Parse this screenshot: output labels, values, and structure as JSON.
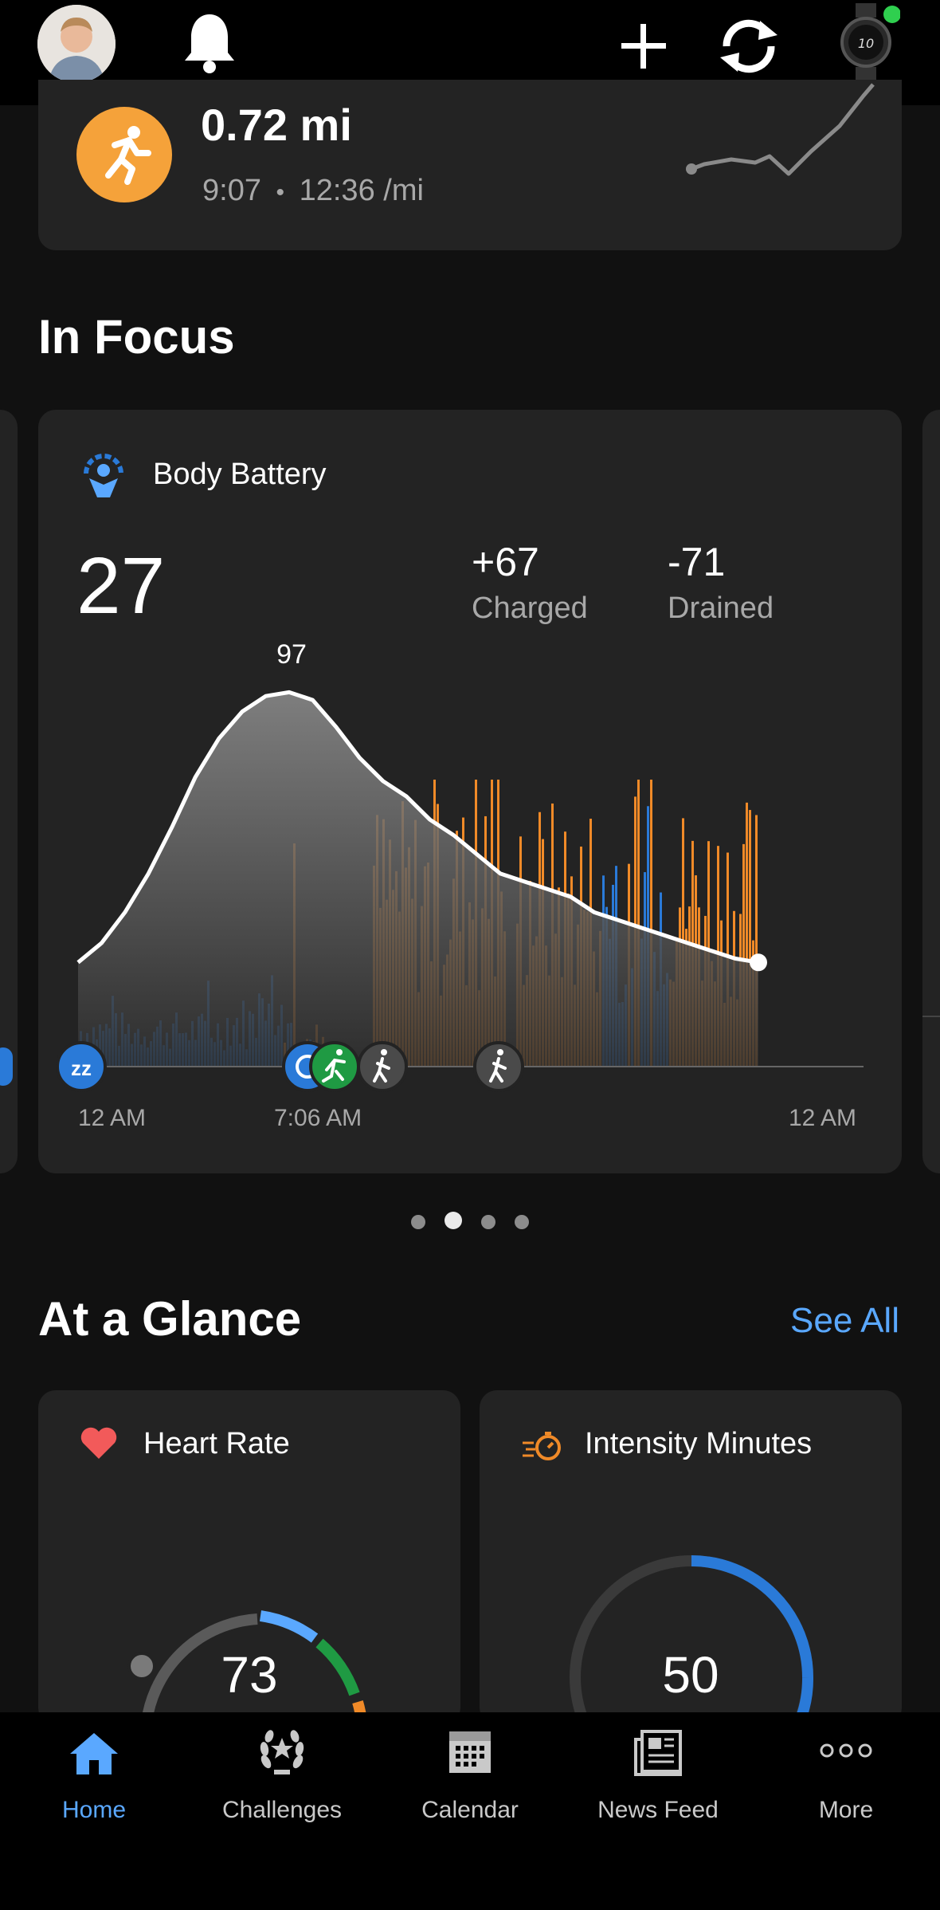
{
  "activity": {
    "distance": "0.72 mi",
    "duration": "9:07",
    "separator": "•",
    "pace": "12:36 /mi"
  },
  "in_focus": {
    "title": "In Focus",
    "card_title": "Body Battery",
    "current_value": "27",
    "charged_value": "+67",
    "charged_label": "Charged",
    "drained_value": "-71",
    "drained_label": "Drained",
    "peak_label": "97",
    "x_labels": [
      "12 AM",
      "7:06 AM",
      "12 AM"
    ],
    "page_count": 4,
    "active_page": 2
  },
  "at_a_glance": {
    "title": "At a Glance",
    "see_all": "See All",
    "heart_rate": {
      "title": "Heart Rate",
      "value": "73"
    },
    "intensity": {
      "title": "Intensity Minutes",
      "value": "50"
    }
  },
  "tabs": [
    {
      "label": "Home",
      "icon": "home-icon",
      "active": true
    },
    {
      "label": "Challenges",
      "icon": "laurel-icon",
      "active": false
    },
    {
      "label": "Calendar",
      "icon": "calendar-icon",
      "active": false
    },
    {
      "label": "News Feed",
      "icon": "newsfeed-icon",
      "active": false
    },
    {
      "label": "More",
      "icon": "more-icon",
      "active": false
    }
  ],
  "colors": {
    "background": "#111111",
    "card": "#232323",
    "accent_blue": "#5aa8ff",
    "orange": "#f08a28",
    "stress_blue": "#2a7ad8",
    "activity_green": "#1f9a43",
    "heart_red": "#f25a5a"
  },
  "chart_data": {
    "type": "area",
    "series": [
      {
        "values": [
          27,
          32,
          40,
          50,
          62,
          75,
          85,
          92,
          96,
          97,
          95,
          88,
          80,
          74,
          70,
          64,
          60,
          55,
          50,
          48,
          46,
          44,
          40,
          38,
          36,
          34,
          32,
          30,
          28,
          27
        ]
      }
    ],
    "ylim": [
      0,
      100
    ]
  }
}
